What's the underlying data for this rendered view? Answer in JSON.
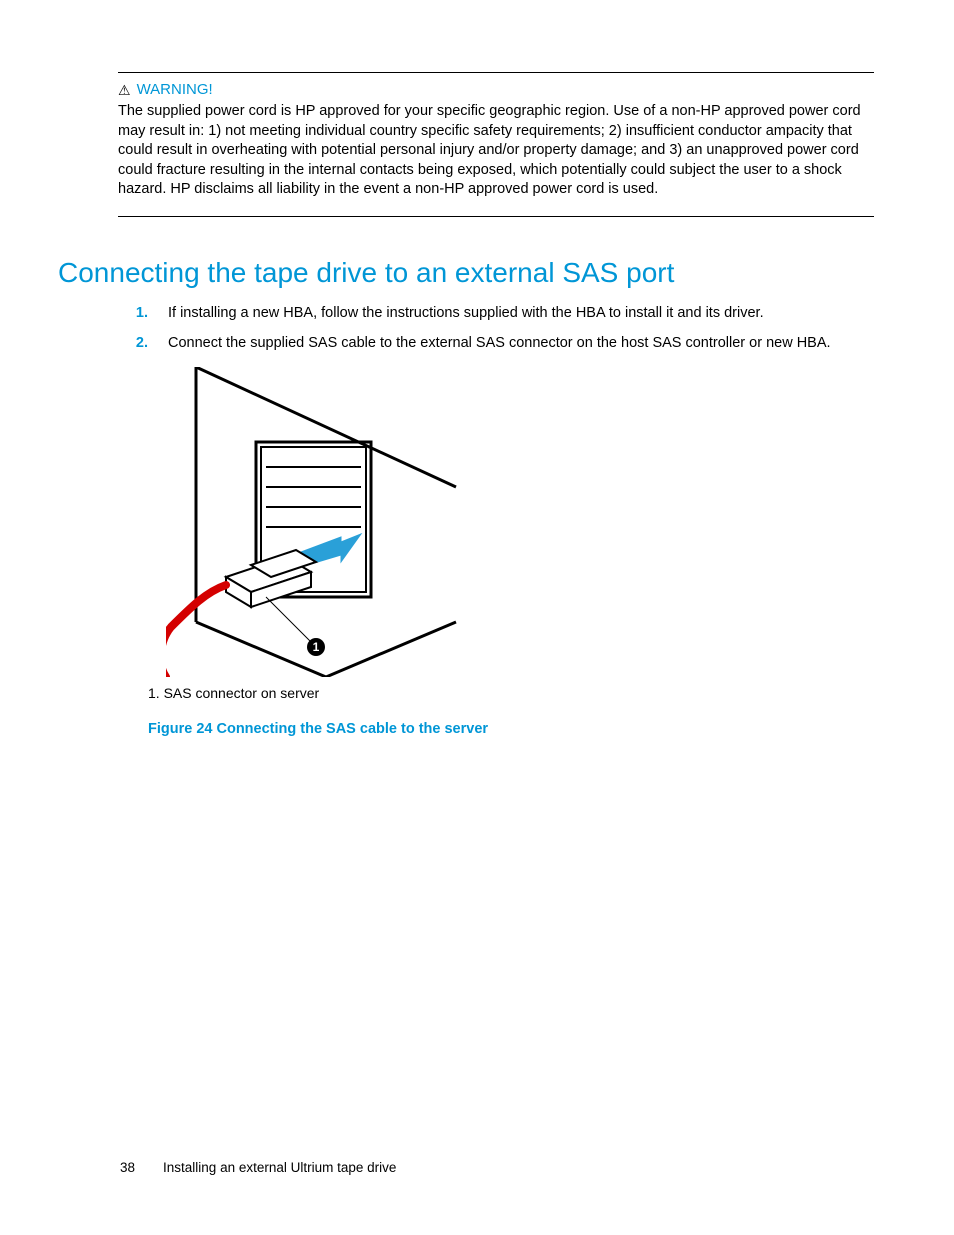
{
  "warning": {
    "title": "WARNING!",
    "body": "The supplied power cord is HP approved for your specific geographic region. Use of a non-HP approved power cord may result in: 1) not meeting individual country specific safety requirements; 2) insufficient conductor ampacity that could result in overheating with potential personal injury and/or property damage; and 3) an unapproved power cord could fracture resulting in the internal contacts being exposed, which potentially could subject the user to a shock hazard. HP disclaims all liability in the event a non-HP approved power cord is used."
  },
  "section": {
    "heading": "Connecting the tape drive to an external SAS port",
    "steps": [
      {
        "num": "1.",
        "text": "If installing a new HBA, follow the instructions supplied with the HBA to install it and its driver."
      },
      {
        "num": "2.",
        "text": "Connect the supplied SAS cable to the external SAS connector on the host SAS controller or new HBA."
      }
    ]
  },
  "figure": {
    "legend": "1. SAS connector on server",
    "caption": "Figure 24 Connecting the SAS cable to the server",
    "callout": "1"
  },
  "footer": {
    "page": "38",
    "chapter": "Installing an external Ultrium tape drive"
  }
}
